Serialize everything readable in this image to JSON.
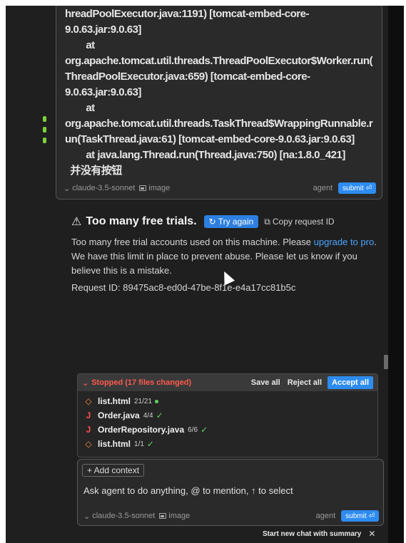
{
  "previous_message": {
    "log_lines": [
      "hreadPoolExecutor.java:1191) [tomcat-embed-core-",
      "9.0.63.jar:9.0.63]",
      "        at",
      "org.apache.tomcat.util.threads.ThreadPoolExecutor$Worker.run(",
      "ThreadPoolExecutor.java:659) [tomcat-embed-core-",
      "9.0.63.jar:9.0.63]",
      "        at",
      "org.apache.tomcat.util.threads.TaskThread$WrappingRunnable.r",
      "un(TaskThread.java:61) [tomcat-embed-core-9.0.63.jar:9.0.63]",
      "        at java.lang.Thread.run(Thread.java:750) [na:1.8.0_421]",
      "  并没有按钮"
    ],
    "model_label": "claude-3.5-sonnet",
    "image_label": "image",
    "mode_label": "agent",
    "submit_label": "submit"
  },
  "error": {
    "title": "Too many free trials.",
    "try_again_label": "Try again",
    "copy_request_label": "Copy request ID",
    "body_before_link": "Too many free trial accounts used on this machine. Please ",
    "link_text": "upgrade to pro",
    "body_after_link": ". We have this limit in place to prevent abuse. Please let us know if you believe this is a mistake.",
    "request_id_text": "Request ID: 89475ac8-ed0d-47be-8f1e-e4a17cc81b5c"
  },
  "changes": {
    "stopped_label": "Stopped (17 files changed)",
    "save_all_label": "Save all",
    "reject_all_label": "Reject all",
    "accept_all_label": "Accept all",
    "files": [
      {
        "icon": "html-file-icon",
        "glyph": "◇",
        "color": "#ff8a3d",
        "name": "list.html",
        "count": "21/21",
        "status": "dot"
      },
      {
        "icon": "java-file-icon",
        "glyph": "J",
        "color": "#ff4d4d",
        "name": "Order.java",
        "count": "4/4",
        "status": "check"
      },
      {
        "icon": "java-file-icon",
        "glyph": "J",
        "color": "#ff4d4d",
        "name": "OrderRepository.java",
        "count": "6/6",
        "status": "check"
      },
      {
        "icon": "html-file-icon",
        "glyph": "◇",
        "color": "#ff8a3d",
        "name": "list.html",
        "count": "1/1",
        "status": "check"
      }
    ]
  },
  "composer": {
    "add_context_label": "+ Add context",
    "prompt_text": "Ask agent to do anything, @ to mention, ↑ to select",
    "model_label": "claude-3.5-sonnet",
    "image_label": "image",
    "mode_label": "agent",
    "submit_label": "submit"
  },
  "new_chat_label": "Start new chat with summary",
  "colors": {
    "accent": "#2d8cf0",
    "stopped": "#ff5a4f",
    "link": "#4aa3ff",
    "success": "#5fd35f"
  }
}
